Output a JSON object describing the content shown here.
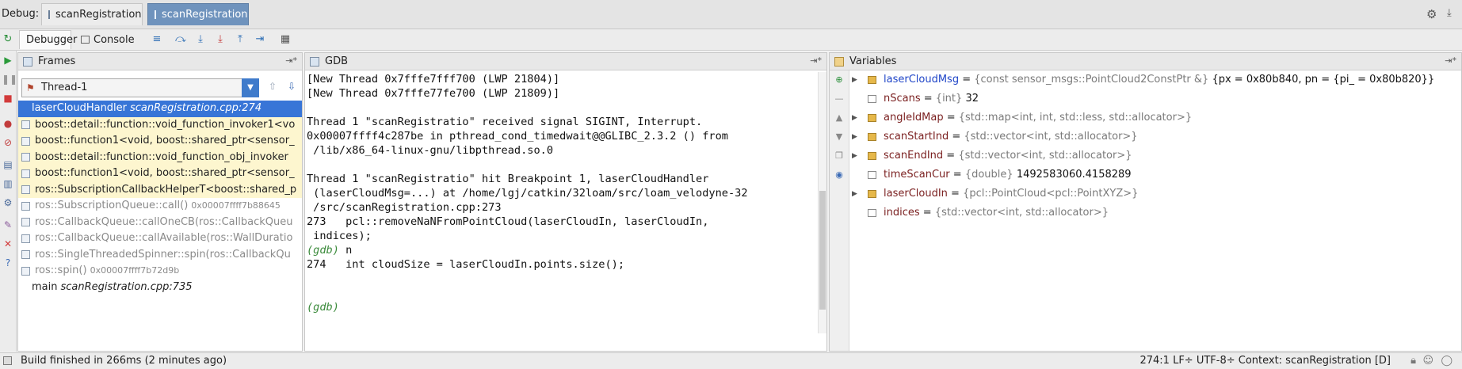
{
  "debug_bar": {
    "label": "Debug:",
    "tabs": [
      {
        "label": "scanRegistration",
        "active": false
      },
      {
        "label": "scanRegistration",
        "active": true
      }
    ]
  },
  "toolbar": {
    "tabs": [
      {
        "label": "Debugger",
        "selected": true
      },
      {
        "label": "Console",
        "selected": false
      }
    ]
  },
  "frames": {
    "title": "Frames",
    "thread": "Thread-1",
    "items": [
      {
        "func": "laserCloudHandler",
        "loc": "scanRegistration.cpp:274",
        "addr": "",
        "style": "sel"
      },
      {
        "func": "boost::detail::function::void_function_invoker1<vo",
        "loc": "",
        "addr": "",
        "style": "lib"
      },
      {
        "func": "boost::function1<void, boost::shared_ptr<sensor_",
        "loc": "",
        "addr": "",
        "style": "lib"
      },
      {
        "func": "boost::detail::function::void_function_obj_invoker",
        "loc": "",
        "addr": "",
        "style": "lib"
      },
      {
        "func": "boost::function1<void, boost::shared_ptr<sensor_",
        "loc": "",
        "addr": "",
        "style": "lib"
      },
      {
        "func": "ros::SubscriptionCallbackHelperT<boost::shared_p",
        "loc": "",
        "addr": "",
        "style": "lib"
      },
      {
        "func": "ros::SubscriptionQueue::call()",
        "loc": "",
        "addr": "0x00007ffff7b88645",
        "style": "gray"
      },
      {
        "func": "ros::CallbackQueue::callOneCB(ros::CallbackQueu",
        "loc": "",
        "addr": "",
        "style": "gray"
      },
      {
        "func": "ros::CallbackQueue::callAvailable(ros::WallDuratio",
        "loc": "",
        "addr": "",
        "style": "gray"
      },
      {
        "func": "ros::SingleThreadedSpinner::spin(ros::CallbackQu",
        "loc": "",
        "addr": "",
        "style": "gray"
      },
      {
        "func": "ros::spin()",
        "loc": "",
        "addr": "0x00007ffff7b72d9b",
        "style": "gray"
      },
      {
        "func": "main",
        "loc": "scanRegistration.cpp:735",
        "addr": "",
        "style": "normal"
      }
    ]
  },
  "gdb": {
    "title": "GDB",
    "lines": [
      {
        "text": "[New Thread 0x7fffe7fff700 (LWP 21804)]",
        "prompt": false
      },
      {
        "text": "[New Thread 0x7fffe77fe700 (LWP 21809)]",
        "prompt": false
      },
      {
        "text": "",
        "prompt": false
      },
      {
        "text": "Thread 1 \"scanRegistratio\" received signal SIGINT, Interrupt.",
        "prompt": false
      },
      {
        "text": "0x00007ffff4c287be in pthread_cond_timedwait@@GLIBC_2.3.2 () from",
        "prompt": false
      },
      {
        "text": " /lib/x86_64-linux-gnu/libpthread.so.0",
        "prompt": false
      },
      {
        "text": "",
        "prompt": false
      },
      {
        "text": "Thread 1 \"scanRegistratio\" hit Breakpoint 1, laserCloudHandler",
        "prompt": false
      },
      {
        "text": " (laserCloudMsg=...) at /home/lgj/catkin/32loam/src/loam_velodyne-32",
        "prompt": false
      },
      {
        "text": " /src/scanRegistration.cpp:273",
        "prompt": false
      },
      {
        "text": "273   pcl::removeNaNFromPointCloud(laserCloudIn, laserCloudIn,",
        "prompt": false
      },
      {
        "text": " indices);",
        "prompt": false
      },
      {
        "text": "(gdb) ",
        "prompt": true,
        "rest": "n"
      },
      {
        "text": "274   int cloudSize = laserCloudIn.points.size();",
        "prompt": false
      },
      {
        "text": "",
        "prompt": false
      },
      {
        "text": "",
        "prompt": false
      },
      {
        "text": "(gdb)",
        "prompt": true,
        "rest": ""
      }
    ]
  },
  "variables": {
    "title": "Variables",
    "items": [
      {
        "name": "laserCloudMsg",
        "type": "{const sensor_msgs::PointCloud2ConstPtr &}",
        "value": "{px = 0x80b840, pn = {pi_ = 0x80b820}}",
        "expandable": true
      },
      {
        "name": "nScans",
        "type": "{int}",
        "value": "32",
        "expandable": false
      },
      {
        "name": "angleIdMap",
        "type": "{std::map<int, int, std::less, std::allocator>}",
        "value": "",
        "expandable": true
      },
      {
        "name": "scanStartInd",
        "type": "{std::vector<int, std::allocator>}",
        "value": "",
        "expandable": true
      },
      {
        "name": "scanEndInd",
        "type": "{std::vector<int, std::allocator>}",
        "value": "",
        "expandable": true
      },
      {
        "name": "timeScanCur",
        "type": "{double}",
        "value": "1492583060.4158289",
        "expandable": false
      },
      {
        "name": "laserCloudIn",
        "type": "{pcl::PointCloud<pcl::PointXYZ>}",
        "value": "",
        "expandable": true
      },
      {
        "name": "indices",
        "type": "{std::vector<int, std::allocator>}",
        "value": "",
        "expandable": false
      }
    ]
  },
  "status": {
    "message": "Build finished in 266ms (2 minutes ago)",
    "right": "274:1   LF÷   UTF-8÷   Context: scanRegistration [D]"
  }
}
